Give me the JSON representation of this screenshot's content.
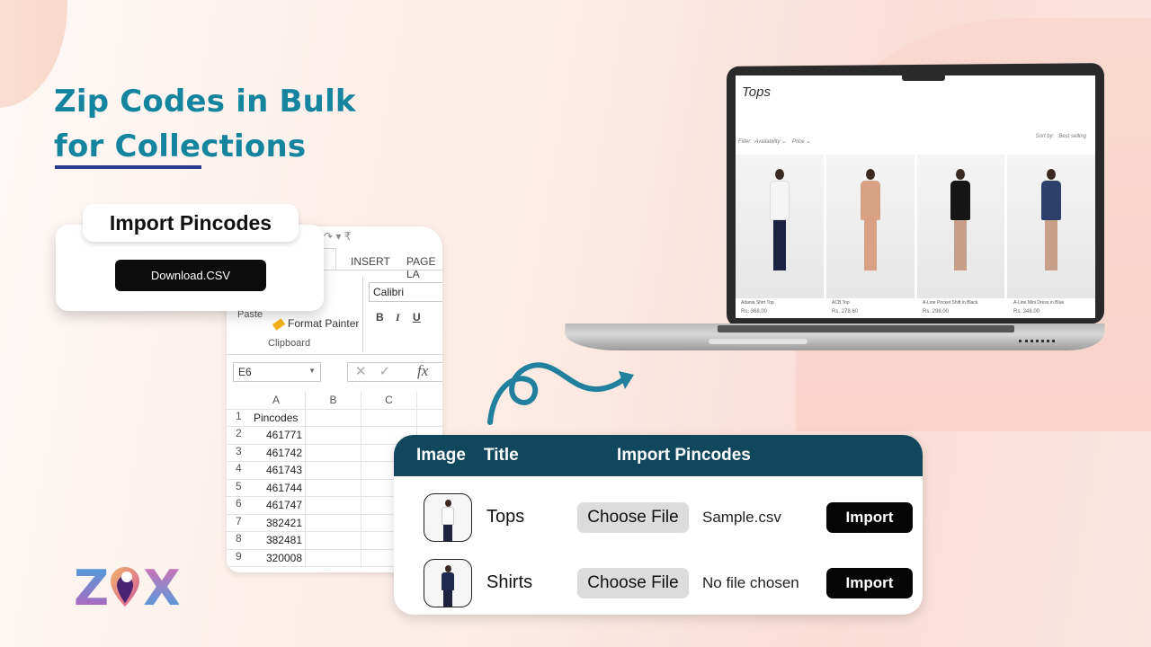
{
  "headline": {
    "line1": "Zip Codes in Bulk",
    "line2": "for Collections",
    "color": "#15849f",
    "underline_color": "#2b3a8e"
  },
  "import_card": {
    "title": "Import Pincodes",
    "download_button": "Download.CSV"
  },
  "excel": {
    "qat": "↷ ▾ ₹",
    "tabs": [
      "INSERT",
      "PAGE LA"
    ],
    "font_name": "Calibri",
    "format_buttons": [
      "B",
      "I",
      "U"
    ],
    "paste_label": "Paste",
    "format_painter_label": "Format Painter",
    "clipboard_group": "Clipboard",
    "name_box": "E6",
    "fx_label": "fx",
    "columns": [
      "A",
      "B",
      "C"
    ],
    "rows": [
      {
        "num": "1",
        "a": "Pincodes"
      },
      {
        "num": "2",
        "a": "461771"
      },
      {
        "num": "3",
        "a": "461742"
      },
      {
        "num": "4",
        "a": "461743"
      },
      {
        "num": "5",
        "a": "461744"
      },
      {
        "num": "6",
        "a": "461747"
      },
      {
        "num": "7",
        "a": "382421"
      },
      {
        "num": "8",
        "a": "382481"
      },
      {
        "num": "9",
        "a": "320008"
      }
    ]
  },
  "laptop_store": {
    "title": "Tops",
    "filter_label": "Filter:",
    "filter_availability": "Availability ⌄",
    "filter_price": "Price ⌄",
    "sort_label": "Sort by:",
    "sort_value": "Best selling",
    "products": [
      {
        "name": "Adania Shirt Top",
        "price": "Rs. 368.00",
        "color": "#f5f5f5"
      },
      {
        "name": "ACB Top",
        "price": "Rs. 278.60",
        "color": "#d9a184"
      },
      {
        "name": "A-Line Pocket Shift in Black",
        "price": "Rs. 298.00",
        "color": "#151515"
      },
      {
        "name": "A-Line Mini Dress in Blue",
        "price": "Rs. 348.00",
        "color": "#2d3f6b"
      }
    ]
  },
  "collections_table": {
    "header_image": "Image",
    "header_title": "Title",
    "header_import": "Import Pincodes",
    "rows": [
      {
        "title": "Tops",
        "choose_label": "Choose File",
        "file": "Sample.csv",
        "import_label": "Import",
        "shirt_color": "#fafafa"
      },
      {
        "title": "Shirts",
        "choose_label": "Choose File",
        "file": "No file chosen",
        "import_label": "Import",
        "shirt_color": "#1f2c4f"
      }
    ]
  },
  "logo": {
    "left": "Z",
    "right": "X"
  }
}
